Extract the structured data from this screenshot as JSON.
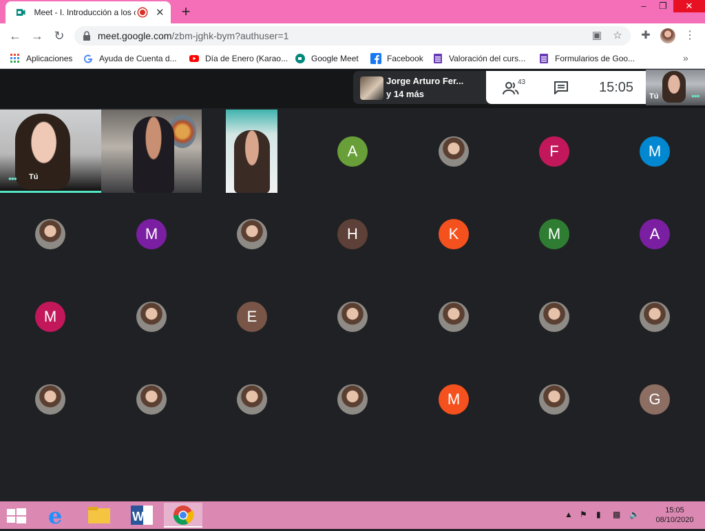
{
  "browser": {
    "tab_title": "Meet - I. Introducción a los c",
    "url_host": "meet.google.com",
    "url_path": "/zbm-jghk-bym?authuser=1",
    "new_tab_label": "+",
    "close_label": "✕",
    "minimize_label": "–",
    "maximize_label": "❐"
  },
  "bookmarks": [
    {
      "label": "Aplicaciones",
      "icon": "apps-grid-icon"
    },
    {
      "label": "Ayuda de Cuenta d...",
      "icon": "google-icon"
    },
    {
      "label": "Día de Enero (Karao...",
      "icon": "youtube-icon"
    },
    {
      "label": "Google Meet",
      "icon": "meet-icon"
    },
    {
      "label": "Facebook",
      "icon": "facebook-icon"
    },
    {
      "label": "Valoración del curs...",
      "icon": "forms-icon"
    },
    {
      "label": "Formularios de Goo...",
      "icon": "forms-icon"
    }
  ],
  "bookmarks_more": "»",
  "meet": {
    "presenter_name": "Jorge Arturo Fer...",
    "presenter_more": "y 14 más",
    "participants_count": "43",
    "time": "15:05",
    "self_label": "Tú",
    "self_dots": "•••",
    "tile1_label": "Tú",
    "tile1_dots": "•••",
    "avatar_rows": [
      [
        {
          "letter": "A",
          "color": "#689f38"
        },
        {
          "letter": "",
          "color": "photo"
        },
        {
          "letter": "F",
          "color": "#c2185b"
        },
        {
          "letter": "M",
          "color": "#0288d1"
        }
      ],
      [
        {
          "letter": "",
          "color": "photo"
        },
        {
          "letter": "M",
          "color": "#7b1fa2"
        },
        {
          "letter": "",
          "color": "photo"
        },
        {
          "letter": "H",
          "color": "#5d4037"
        },
        {
          "letter": "K",
          "color": "#f4511e"
        },
        {
          "letter": "M",
          "color": "#2e7d32"
        },
        {
          "letter": "A",
          "color": "#7b1fa2"
        }
      ],
      [
        {
          "letter": "M",
          "color": "#c2185b"
        },
        {
          "letter": "",
          "color": "photo"
        },
        {
          "letter": "E",
          "color": "#795548"
        },
        {
          "letter": "",
          "color": "photo"
        },
        {
          "letter": "",
          "color": "photo"
        },
        {
          "letter": "",
          "color": "photo"
        },
        {
          "letter": "",
          "color": "photo"
        }
      ],
      [
        {
          "letter": "",
          "color": "photo"
        },
        {
          "letter": "",
          "color": "photo"
        },
        {
          "letter": "",
          "color": "photo"
        },
        {
          "letter": "",
          "color": "photo"
        },
        {
          "letter": "M",
          "color": "#f4511e"
        },
        {
          "letter": "",
          "color": "photo"
        },
        {
          "letter": "G",
          "color": "#8d6e63"
        }
      ]
    ]
  },
  "taskbar": {
    "time": "15:05",
    "date": "08/10/2020"
  }
}
